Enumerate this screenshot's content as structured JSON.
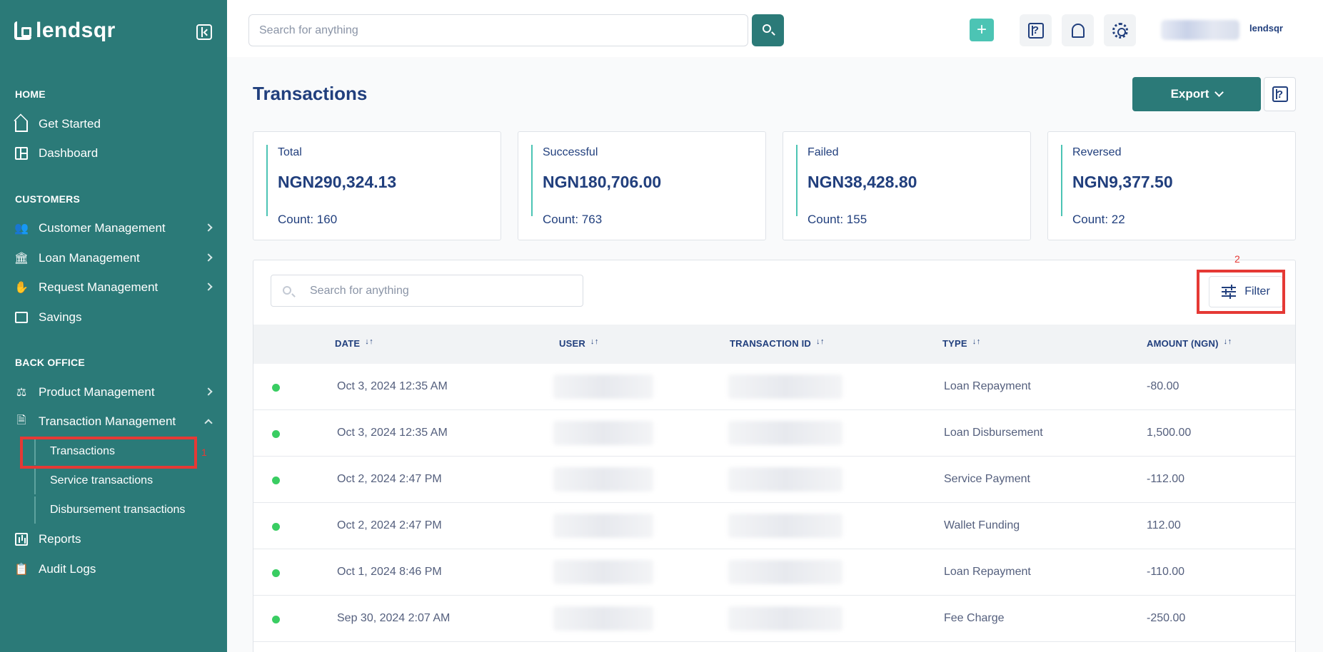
{
  "brand": {
    "name": "lendsqr",
    "small": "lendsqr"
  },
  "topbar": {
    "search_placeholder": "Search for anything",
    "add_icon": "+"
  },
  "sidebar": {
    "sections": {
      "home": "HOME",
      "customers": "CUSTOMERS",
      "back_office": "BACK OFFICE"
    },
    "items": {
      "get_started": "Get Started",
      "dashboard": "Dashboard",
      "customer_management": "Customer Management",
      "loan_management": "Loan Management",
      "request_management": "Request Management",
      "savings": "Savings",
      "product_management": "Product Management",
      "transaction_management": "Transaction Management",
      "reports": "Reports",
      "audit_logs": "Audit Logs"
    },
    "sub_items": {
      "transactions": "Transactions",
      "service_transactions": "Service transactions",
      "disbursement_transactions": "Disbursement transactions"
    }
  },
  "annotations": {
    "one": "1",
    "two": "2"
  },
  "page": {
    "title": "Transactions",
    "export_label": "Export"
  },
  "stats": [
    {
      "label": "Total",
      "value": "NGN290,324.13",
      "count": "Count: 160"
    },
    {
      "label": "Successful",
      "value": "NGN180,706.00",
      "count": "Count: 763"
    },
    {
      "label": "Failed",
      "value": "NGN38,428.80",
      "count": "Count: 155"
    },
    {
      "label": "Reversed",
      "value": "NGN9,377.50",
      "count": "Count: 22"
    }
  ],
  "table": {
    "search_placeholder": "Search for anything",
    "filter_label": "Filter",
    "headers": {
      "date": "DATE",
      "user": "USER",
      "transaction_id": "TRANSACTION ID",
      "type": "TYPE",
      "amount": "AMOUNT (NGN)"
    },
    "status_color": "#39cd62",
    "rows": [
      {
        "date": "Oct 3, 2024 12:35 AM",
        "type": "Loan Repayment",
        "amount": "-80.00"
      },
      {
        "date": "Oct 3, 2024 12:35 AM",
        "type": "Loan Disbursement",
        "amount": "1,500.00"
      },
      {
        "date": "Oct 2, 2024 2:47 PM",
        "type": "Service Payment",
        "amount": "-112.00"
      },
      {
        "date": "Oct 2, 2024 2:47 PM",
        "type": "Wallet Funding",
        "amount": "112.00"
      },
      {
        "date": "Oct 1, 2024 8:46 PM",
        "type": "Loan Repayment",
        "amount": "-110.00"
      },
      {
        "date": "Sep 30, 2024 2:07 AM",
        "type": "Fee Charge",
        "amount": "-250.00"
      }
    ]
  }
}
